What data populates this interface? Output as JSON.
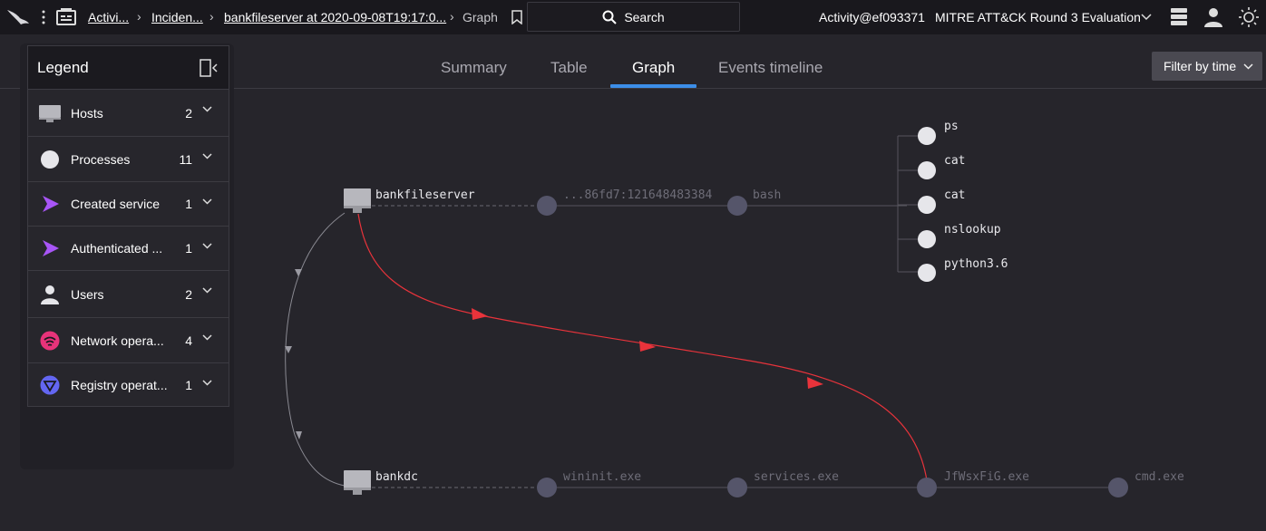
{
  "topbar": {
    "crumbs": [
      "Activi...",
      "Inciden...",
      "bankfileserver at 2020-09-08T19:17:0...",
      "Graph"
    ],
    "search_label": "Search",
    "account": "Activity@ef093371",
    "customer": "MITRE ATT&CK Round 3 Evaluation"
  },
  "tabs": [
    "Summary",
    "Table",
    "Graph",
    "Events timeline"
  ],
  "active_tab": "Graph",
  "filter_label": "Filter by time",
  "legend": {
    "title": "Legend",
    "items": [
      {
        "label": "Hosts",
        "count": "2",
        "icon": "monitor-icon"
      },
      {
        "label": "Processes",
        "count": "11",
        "icon": "process-circle-icon"
      },
      {
        "label": "Created service",
        "count": "1",
        "icon": "arrow-right-icon"
      },
      {
        "label": "Authenticated ...",
        "count": "1",
        "icon": "arrow-right-icon"
      },
      {
        "label": "Users",
        "count": "2",
        "icon": "user-icon"
      },
      {
        "label": "Network opera...",
        "count": "4",
        "icon": "network-icon"
      },
      {
        "label": "Registry operat...",
        "count": "1",
        "icon": "registry-icon"
      }
    ]
  },
  "graph": {
    "hosts": [
      "bankfileserver",
      "bankdc"
    ],
    "top_chain": [
      "...86fd7:121648483384",
      "bash"
    ],
    "bash_children": [
      "ps",
      "cat",
      "cat",
      "nslookup",
      "python3.6"
    ],
    "bottom_chain": [
      "wininit.exe",
      "services.exe",
      "JfWsxFiG.exe",
      "cmd.exe"
    ]
  },
  "colors": {
    "accent_blue": "#3c8ee8",
    "edge_red": "#e8333b",
    "service_purple": "#a855f7",
    "network_pink": "#e8337a",
    "registry_indigo": "#6366f1"
  }
}
